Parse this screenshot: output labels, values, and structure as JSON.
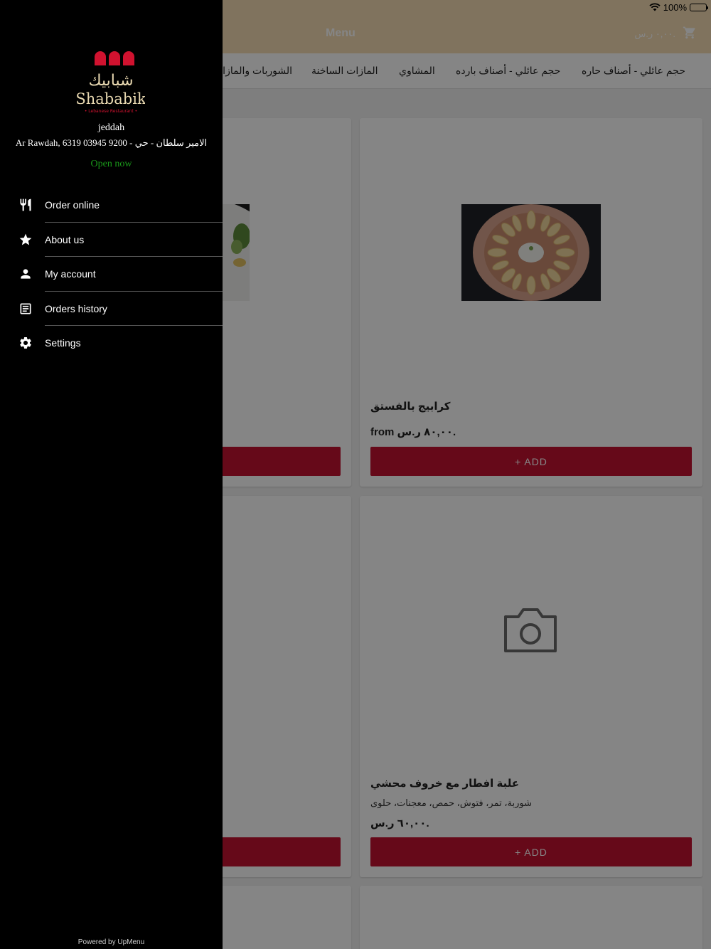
{
  "status_bar": {
    "battery": "100%"
  },
  "app_bar": {
    "title": "Menu",
    "cart_total": "٠,٠٠ ر.س."
  },
  "tabs": [
    "حجم عائلي - أصناف حاره",
    "حجم عائلي - أصناف بارده",
    "المشاوي",
    "المازات الساخنة",
    "الشوربات والمازات"
  ],
  "cards": [
    {
      "name": "كرابيج بالفستق",
      "price": "from ٨٠,٠٠ ر.س.",
      "add_label": "+ ADD"
    },
    {
      "name": "علبة افطار مع خروف محشي",
      "description": "شوربة، تمر، فتوش، حمص، معجنات، حلوى",
      "price": "٦٠,٠٠ ر.س.",
      "add_label": "+ ADD"
    }
  ],
  "drawer": {
    "logo_text_arabic": "شبابيك",
    "logo_text_latin": "Shababik",
    "logo_tagline": "• Lebanese Restaurant •",
    "branch_name": "jeddah",
    "branch_address": "Ar Rawdah, 6319 03945 9200 - الامير سلطان - حي",
    "open_status": "Open now",
    "menu": [
      {
        "label": "Order online",
        "icon": "fork-knife-icon"
      },
      {
        "label": "About us",
        "icon": "star-icon"
      },
      {
        "label": "My account",
        "icon": "person-icon"
      },
      {
        "label": "Orders history",
        "icon": "receipt-icon"
      },
      {
        "label": "Settings",
        "icon": "gear-icon"
      }
    ],
    "powered_by": "Powered by UpMenu"
  },
  "colors": {
    "accent": "#c41230",
    "drawer_bg": "#000000",
    "open_status": "#1a9a1a",
    "app_bar": "#f5ddb4"
  }
}
